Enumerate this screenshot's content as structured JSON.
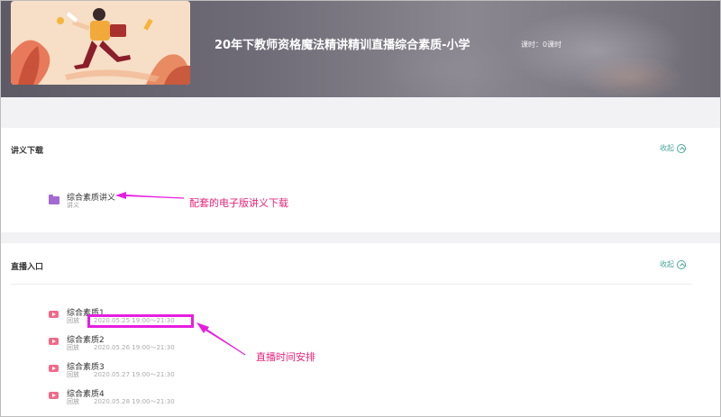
{
  "header": {
    "course_title": "20年下教师资格魔法精讲精训直播综合素质-小学",
    "hours_label": "课时：0课时"
  },
  "handouts": {
    "title": "讲义下载",
    "collapse_label": "收起",
    "items": [
      {
        "name": "综合素质讲义",
        "type": "讲义"
      }
    ]
  },
  "live": {
    "title": "直播入口",
    "collapse_label": "收起",
    "items": [
      {
        "name": "综合素质1",
        "status": "回放",
        "time": "2020.05.25 19:00～21:30"
      },
      {
        "name": "综合素质2",
        "status": "回放",
        "time": "2020.05.26 19:00～21:30"
      },
      {
        "name": "综合素质3",
        "status": "回放",
        "time": "2020.05.27 19:00～21:30"
      },
      {
        "name": "综合素质4",
        "status": "回放",
        "time": "2020.05.28 19:00～21:30"
      }
    ]
  },
  "annotations": {
    "handout_note": "配套的电子版讲义下载",
    "schedule_note": "直播时间安排"
  },
  "colors": {
    "accent": "#4aa69a",
    "annotation": "#e8257a",
    "highlight": "#e61ee0",
    "folder": "#a56ad2",
    "play": "#f06a8a"
  }
}
